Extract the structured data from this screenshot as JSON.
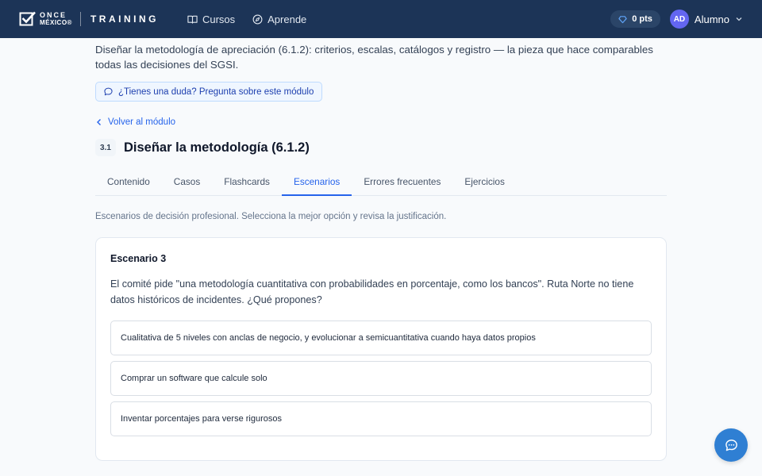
{
  "header": {
    "logo_top": "ONCE",
    "logo_bottom": "MÉXICO®",
    "logo_product": "TRAINING",
    "nav": [
      {
        "label": "Cursos",
        "icon": "book-icon"
      },
      {
        "label": "Aprende",
        "icon": "compass-icon"
      }
    ],
    "points": "0 pts",
    "user": {
      "initials": "AD",
      "name": "Alumno"
    }
  },
  "module": {
    "intro": "Diseñar la metodología de apreciación (6.1.2): criterios, escalas, catálogos y registro — la pieza que hace comparables todas las decisiones del SGSI.",
    "ask_label": "¿Tienes una duda? Pregunta sobre este módulo",
    "back_label": "Volver al módulo",
    "badge": "3.1",
    "title": "Diseñar la metodología (6.1.2)"
  },
  "tabs": [
    {
      "label": "Contenido",
      "active": false
    },
    {
      "label": "Casos",
      "active": false
    },
    {
      "label": "Flashcards",
      "active": false
    },
    {
      "label": "Escenarios",
      "active": true
    },
    {
      "label": "Errores frecuentes",
      "active": false
    },
    {
      "label": "Ejercicios",
      "active": false
    }
  ],
  "scenarios": {
    "subtitle": "Escenarios de decisión profesional. Selecciona la mejor opción y revisa la justificación.",
    "card_title": "Escenario 3",
    "question": "El comité pide \"una metodología cuantitativa con probabilidades en porcentaje, como los bancos\". Ruta Norte no tiene datos históricos de incidentes. ¿Qué propones?",
    "options": [
      "Cualitativa de 5 niveles con anclas de negocio, y evolucionar a semicuantitativa cuando haya datos propios",
      "Comprar un software que calcule solo",
      "Inventar porcentajes para verse rigurosos"
    ]
  },
  "colors": {
    "header_bg": "#1c3457",
    "accent": "#2563eb",
    "fab": "#2f7fd3",
    "avatar": "#6366f1"
  }
}
